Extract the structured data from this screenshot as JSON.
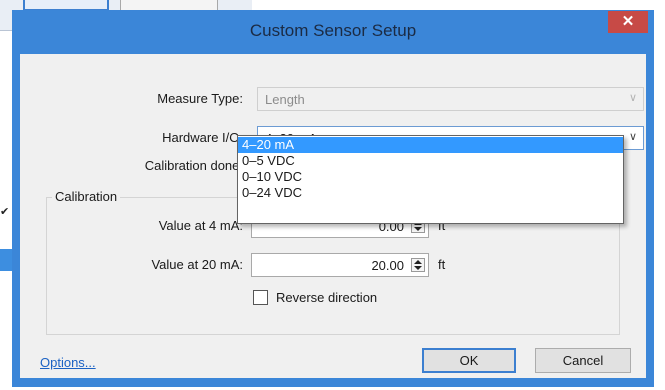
{
  "dialog": {
    "title": "Custom Sensor Setup",
    "close_icon": "close-icon",
    "close_glyph": "✕"
  },
  "form": {
    "measure_type_label": "Measure Type:",
    "measure_type_value": "Length",
    "hardware_io_label": "Hardware I/O:",
    "hardware_io_value": "4–20 mA",
    "calibration_done_label": "Calibration done:"
  },
  "dropdown_options": [
    "4–20 mA",
    "0–5 VDC",
    "0–10 VDC",
    "0–24 VDC"
  ],
  "dropdown_selected_index": 0,
  "calibration": {
    "group_title": "Calibration",
    "value4_label": "Value at 4 mA:",
    "value4_value": "0.00",
    "value4_unit": "ft",
    "value20_label": "Value at 20 mA:",
    "value20_value": "20.00",
    "value20_unit": "ft",
    "reverse_label": "Reverse direction",
    "reverse_checked": false
  },
  "footer": {
    "options_link": "Options...",
    "ok_label": "OK",
    "cancel_label": "Cancel"
  },
  "colors": {
    "frame": "#3b86d8",
    "close": "#c74a46",
    "selection": "#3399ff",
    "link": "#1b62c4"
  },
  "icons": {
    "chevron": "chevron-down-icon",
    "spin": "spin-updown-icon"
  }
}
